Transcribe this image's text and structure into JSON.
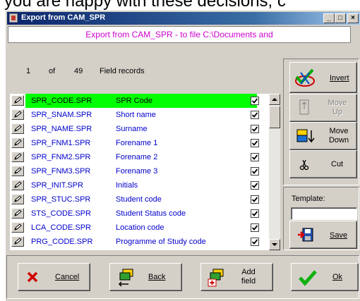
{
  "background_text": "you are happy with these decisions, c",
  "window": {
    "title": "Export from CAM_SPR",
    "buttons": {
      "minimize": "_",
      "restore": "□",
      "close": "×"
    }
  },
  "header": {
    "text": "Export from CAM_SPR - to file C:\\Documents and"
  },
  "counter": {
    "current": "1",
    "of": "of",
    "total": "49",
    "label": "Field records"
  },
  "rows": [
    {
      "code": "SPR_CODE.SPR",
      "desc": "SPR Code",
      "checked": true,
      "selected": true
    },
    {
      "code": "SPR_SNAM.SPR",
      "desc": "Short name",
      "checked": true
    },
    {
      "code": "SPR_NAME.SPR",
      "desc": "Surname",
      "checked": true
    },
    {
      "code": "SPR_FNM1.SPR",
      "desc": "Forename 1",
      "checked": true
    },
    {
      "code": "SPR_FNM2.SPR",
      "desc": "Forename 2",
      "checked": true
    },
    {
      "code": "SPR_FNM3.SPR",
      "desc": "Forename 3",
      "checked": true
    },
    {
      "code": "SPR_INIT.SPR",
      "desc": "Initials",
      "checked": true
    },
    {
      "code": "SPR_STUC.SPR",
      "desc": "Student code",
      "checked": true
    },
    {
      "code": "STS_CODE.SPR",
      "desc": "Student Status code",
      "checked": true
    },
    {
      "code": "LCA_CODE.SPR",
      "desc": "Location code",
      "checked": true
    },
    {
      "code": "PRG_CODE.SPR",
      "desc": "Programme of Study code",
      "checked": true
    }
  ],
  "side": {
    "invert": "Invert",
    "move_up_1": "Move",
    "move_up_2": "Up",
    "move_down_1": "Move",
    "move_down_2": "Down",
    "cut": "Cut",
    "template_label": "Template:",
    "template_value": "",
    "save": "Save"
  },
  "bottom": {
    "cancel": "Cancel",
    "back": "Back",
    "add_field_1": "Add",
    "add_field_2": "field",
    "ok": "Ok"
  },
  "colors": {
    "selected_row": "#00ff00",
    "field_text": "#0000cc",
    "header_text": "#cc00cc",
    "title_bar": "#0a246a"
  }
}
